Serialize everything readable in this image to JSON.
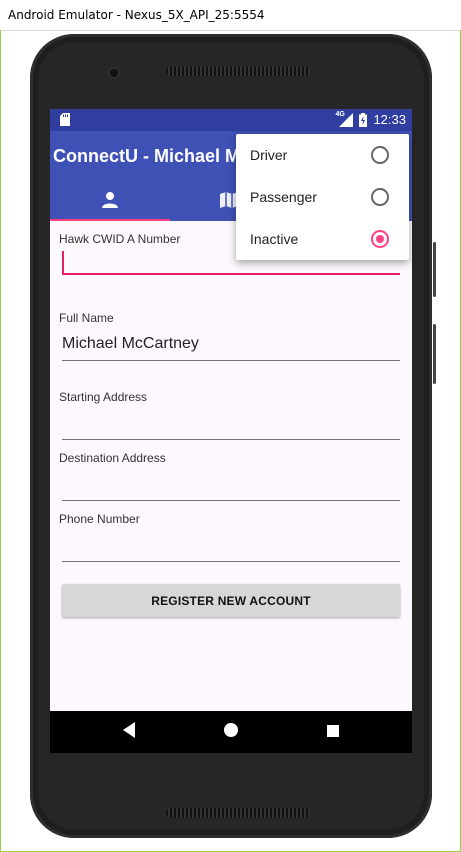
{
  "window": {
    "title": "Android Emulator - Nexus_5X_API_25:5554"
  },
  "status_bar": {
    "network": "4G",
    "time": "12:33"
  },
  "app_bar": {
    "title": "ConnectU - Michael McCartney"
  },
  "tabs": [
    {
      "icon": "person-icon"
    },
    {
      "icon": "map-icon"
    }
  ],
  "form": {
    "fields": [
      {
        "label": "Hawk CWID A Number",
        "value": ""
      },
      {
        "label": "Full Name",
        "value": "Michael McCartney"
      },
      {
        "label": "Starting Address",
        "value": ""
      },
      {
        "label": "Destination Address",
        "value": ""
      },
      {
        "label": "Phone Number",
        "value": ""
      }
    ],
    "register_button": "REGISTER NEW ACCOUNT"
  },
  "menu": {
    "items": [
      {
        "label": "Driver",
        "selected": false
      },
      {
        "label": "Passenger",
        "selected": false
      },
      {
        "label": "Inactive",
        "selected": true
      }
    ]
  },
  "colors": {
    "primary": "#3f51b5",
    "primary_dark": "#303f9f",
    "accent": "#ff4081"
  }
}
